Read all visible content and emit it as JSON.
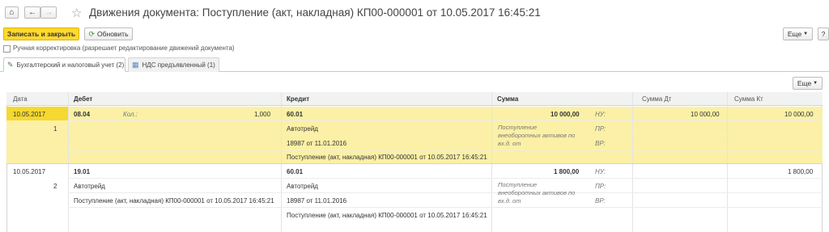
{
  "header": {
    "title": "Движения документа: Поступление (акт, накладная) КП00-000001 от 10.05.2017 16:45:21"
  },
  "toolbar": {
    "save_close": "Записать и закрыть",
    "refresh": "Обновить",
    "more": "Еще",
    "help": "?"
  },
  "manual": {
    "label": "Ручная корректировка (разрешает редактирование движений документа)"
  },
  "tabs": [
    {
      "label": "Бухгалтерский и налоговый учет (2)"
    },
    {
      "label": "НДС предъявленный (1)"
    }
  ],
  "table": {
    "more": "Еще",
    "columns": {
      "date": "Дата",
      "debit": "Дебет",
      "credit": "Кредит",
      "sum": "Сумма",
      "sum_dt": "Сумма Дт",
      "sum_kt": "Сумма Кт"
    },
    "rows": [
      {
        "date": "10.05.2017",
        "num": "1",
        "debit_account": "08.04",
        "qty_label": "Кол.:",
        "qty": "1,000",
        "debit_sub1": "",
        "debit_sub2": "",
        "credit_account": "60.01",
        "credit_sub1": "Автотрейд",
        "credit_sub2": "18987 от 11.01.2016",
        "credit_sub3": "Поступление (акт, накладная) КП00-000001 от 10.05.2017 16:45:21",
        "sum": "10 000,00",
        "content": "Поступление внеоборотных активов по вх.д.  от",
        "nu": "НУ:",
        "pr": "ПР:",
        "vr": "ВР:",
        "sum_dt": "10 000,00",
        "sum_kt": "10 000,00"
      },
      {
        "date": "10.05.2017",
        "num": "2",
        "debit_account": "19.01",
        "debit_sub1": "Автотрейд",
        "debit_sub2": "Поступление (акт, накладная) КП00-000001 от 10.05.2017 16:45:21",
        "credit_account": "60.01",
        "credit_sub1": "Автотрейд",
        "credit_sub2": "18987 от 11.01.2016",
        "credit_sub3": "Поступление (акт, накладная) КП00-000001 от 10.05.2017 16:45:21",
        "sum": "1 800,00",
        "content": "Поступление внеоборотных активов по вх.д.  от",
        "nu": "НУ:",
        "pr": "ПР:",
        "vr": "ВР:",
        "sum_dt": "",
        "sum_kt": "1 800,00"
      }
    ]
  }
}
